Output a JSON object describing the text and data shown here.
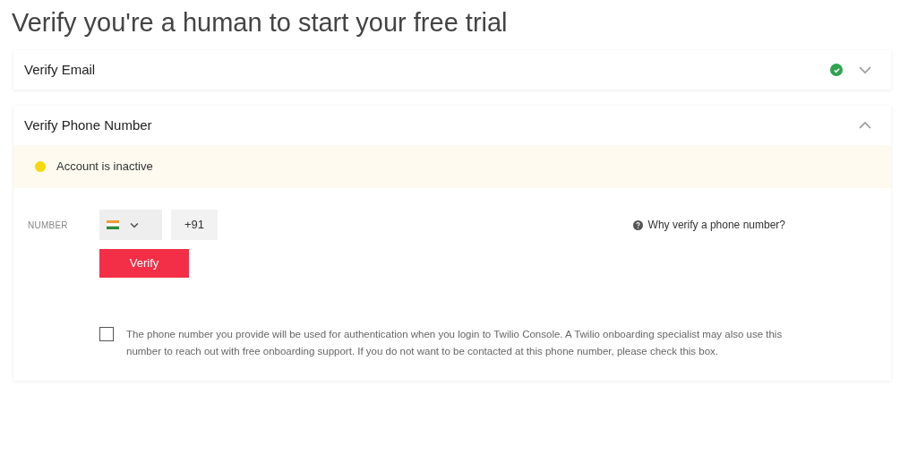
{
  "title": "Verify you're a human to start your free trial",
  "sections": [
    {
      "title": "Verify Email",
      "verified": true,
      "expanded": false
    },
    {
      "title": "Verify Phone Number",
      "verified": false,
      "expanded": true
    }
  ],
  "status": {
    "text": "Account is inactive",
    "color": "#f5d90a"
  },
  "number": {
    "label": "NUMBER",
    "country_code": "+91"
  },
  "help_link": "Why verify a phone number?",
  "verify_button": "Verify",
  "consent": {
    "checked": false,
    "text": "The phone number you provide will be used for authentication when you login to Twilio Console. A Twilio onboarding specialist may also use this number to reach out with free onboarding support. If you do not want to be contacted at this phone number, please check this box."
  }
}
